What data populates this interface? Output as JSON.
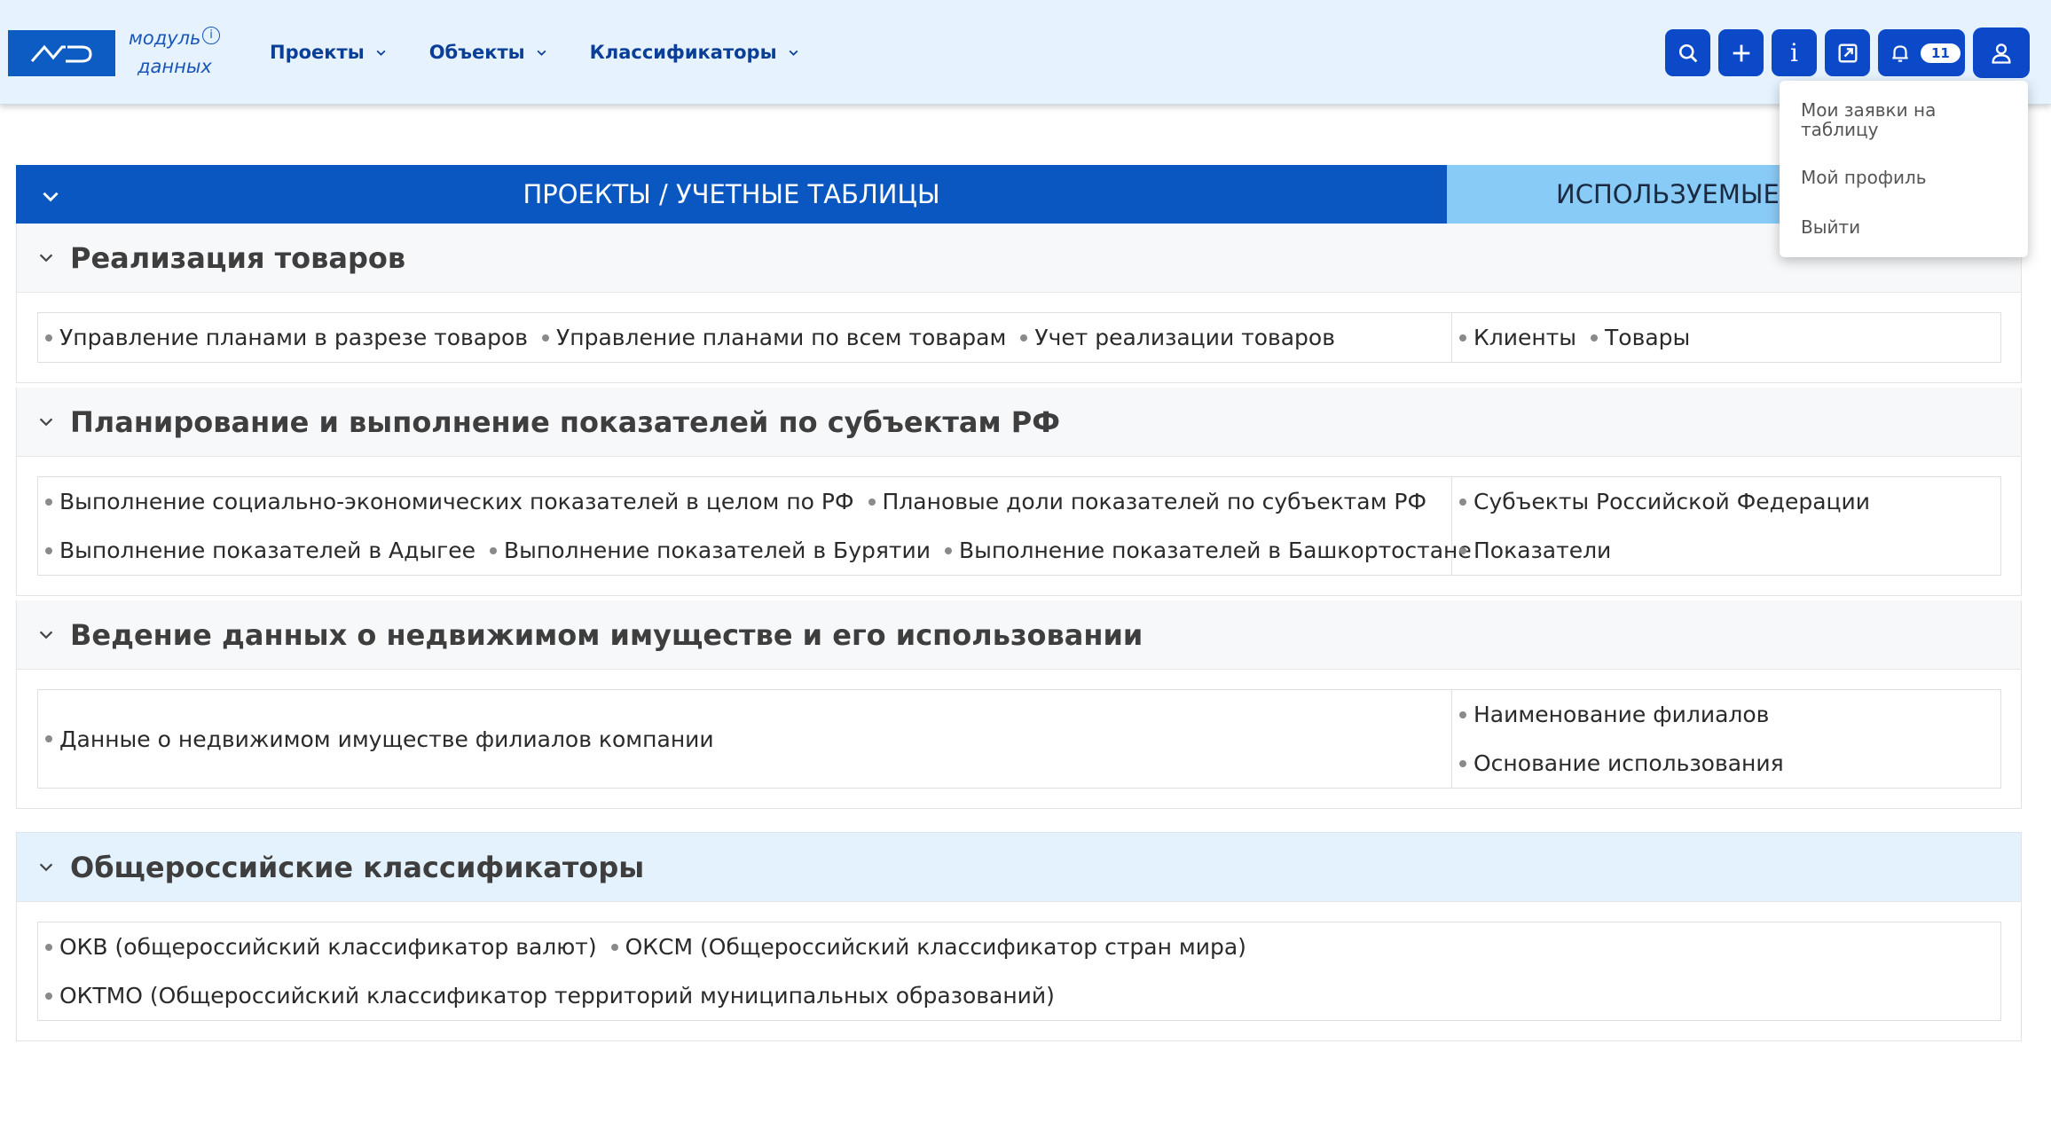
{
  "header": {
    "brand_line1": "модуль",
    "brand_line2": "данных",
    "info_glyph": "i",
    "nav": [
      {
        "label": "Проекты",
        "icon": "chevron-down-icon"
      },
      {
        "label": "Объекты",
        "icon": "chevron-down-icon"
      },
      {
        "label": "Классификаторы",
        "icon": "chevron-down-icon"
      }
    ],
    "actions": {
      "search_icon": "search-icon",
      "add_icon": "plus-icon",
      "info_label": "i",
      "export_icon": "external-link-icon",
      "bell_icon": "bell-icon",
      "notifications_count": "11",
      "user_icon": "user-icon"
    },
    "accent_color": "#0c49c9",
    "bg_color": "#e6f3fe"
  },
  "user_menu": {
    "items": [
      "Мои заявки на таблицу",
      "Мой профиль",
      "Выйти"
    ]
  },
  "table": {
    "col_main": "ПРОЕКТЫ / УЧЕТНЫЕ ТАБЛИЦЫ",
    "col_side": "ИСПОЛЬЗУЕМЫЕ",
    "main_color": "#0a57c2",
    "side_color": "#89cbf7"
  },
  "groups": [
    {
      "title": "Реализация товаров",
      "main_lines": [
        [
          "Управление планами в разрезе товаров",
          "Управление планами по всем товарам",
          "Учет реализации товаров"
        ]
      ],
      "side_lines": [
        [
          "Клиенты",
          "Товары"
        ]
      ]
    },
    {
      "title": "Планирование и выполнение показателей по субъектам РФ",
      "main_lines": [
        [
          "Выполнение социально-экономических показателей в целом по РФ",
          "Плановые доли показателей по субъектам РФ"
        ],
        [
          "Выполнение показателей в Адыгее",
          "Выполнение показателей в Бурятии",
          "Выполнение показателей в Башкортостане"
        ]
      ],
      "side_lines": [
        [
          "Субъекты Российской Федерации"
        ],
        [
          "Показатели"
        ]
      ]
    },
    {
      "title": "Ведение данных о недвижимом имуществе и его использовании",
      "main_lines": [
        [
          "Данные о недвижимом имуществе филиалов компании"
        ]
      ],
      "side_lines": [
        [
          "Наименование филиалов"
        ],
        [
          "Основание использования"
        ]
      ]
    }
  ],
  "classifiers": {
    "title": "Общероссийские классификаторы",
    "lines": [
      [
        "ОКВ (общероссийский классификатор валют)",
        "ОКСМ (Общероссийский классификатор стран мира)"
      ],
      [
        "ОКТМО (Общероссийский классификатор территорий муниципальных образований)"
      ]
    ]
  }
}
